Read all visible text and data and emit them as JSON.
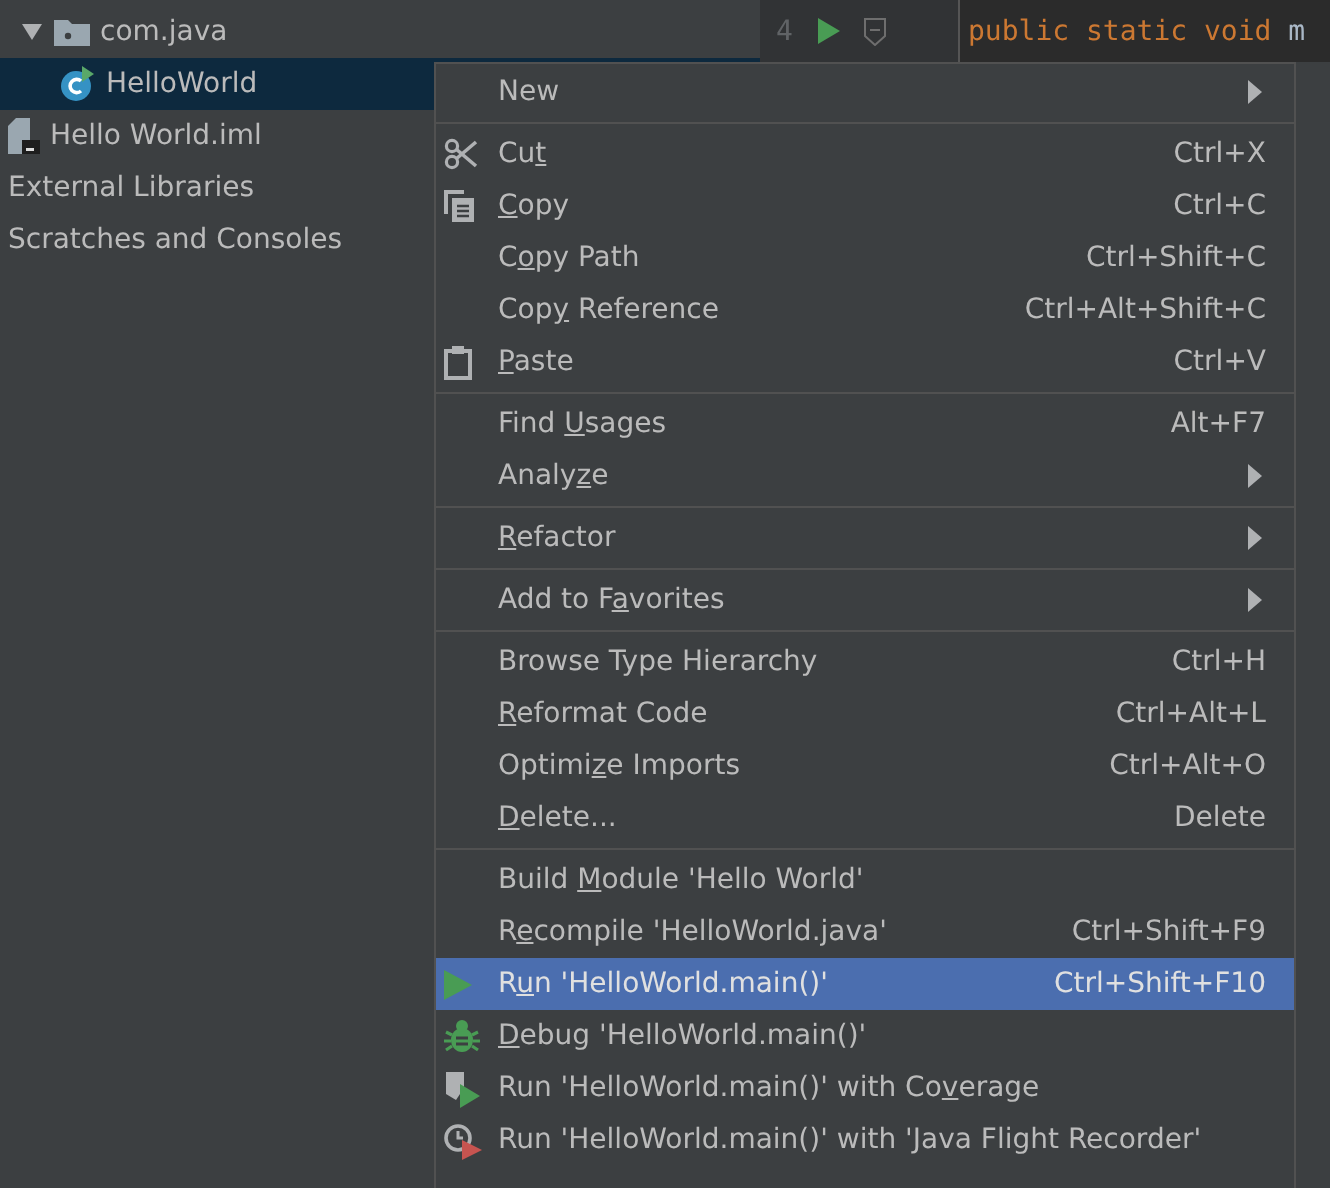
{
  "project_tree": [
    {
      "label": "com.java",
      "kind": "package",
      "expanded": true,
      "selected": false,
      "children": [
        {
          "label": "HelloWorld",
          "kind": "class",
          "selected": true
        }
      ]
    },
    {
      "label": "Hello World.iml",
      "kind": "file",
      "selected": false
    },
    {
      "label": "External Libraries",
      "kind": "plain",
      "selected": false
    },
    {
      "label": "Scratches and Consoles",
      "kind": "plain",
      "selected": false
    }
  ],
  "editor": {
    "line_number": "4",
    "code": [
      {
        "text": "public static void ",
        "kind": "keyword"
      },
      {
        "text": "m",
        "kind": "plain"
      }
    ]
  },
  "context_menu": {
    "groups": [
      [
        {
          "label": [
            {
              "text": "New",
              "underlined": false
            }
          ],
          "kind": "submenu",
          "selected": false
        }
      ],
      [
        {
          "label": [
            {
              "text": "Cu",
              "underlined": false
            },
            {
              "text": "t",
              "underlined": true
            }
          ],
          "shortcut": "Ctrl+X",
          "kind": "command",
          "selected": false
        },
        {
          "label": [
            {
              "text": "C",
              "underlined": true
            },
            {
              "text": "opy",
              "underlined": false
            }
          ],
          "shortcut": "Ctrl+C",
          "kind": "command",
          "selected": false
        },
        {
          "label": [
            {
              "text": "C",
              "underlined": false
            },
            {
              "text": "o",
              "underlined": true
            },
            {
              "text": "py Path",
              "underlined": false
            }
          ],
          "shortcut": "Ctrl+Shift+C",
          "kind": "command",
          "selected": false
        },
        {
          "label": [
            {
              "text": "Cop",
              "underlined": false
            },
            {
              "text": "y",
              "underlined": true
            },
            {
              "text": " Reference",
              "underlined": false
            }
          ],
          "shortcut": "Ctrl+Alt+Shift+C",
          "kind": "command",
          "selected": false
        },
        {
          "label": [
            {
              "text": "P",
              "underlined": true
            },
            {
              "text": "aste",
              "underlined": false
            }
          ],
          "shortcut": "Ctrl+V",
          "kind": "command",
          "selected": false
        }
      ],
      [
        {
          "label": [
            {
              "text": "Find ",
              "underlined": false
            },
            {
              "text": "U",
              "underlined": true
            },
            {
              "text": "sages",
              "underlined": false
            }
          ],
          "shortcut": "Alt+F7",
          "kind": "command",
          "selected": false
        },
        {
          "label": [
            {
              "text": "Analy",
              "underlined": false
            },
            {
              "text": "z",
              "underlined": true
            },
            {
              "text": "e",
              "underlined": false
            }
          ],
          "kind": "submenu",
          "selected": false
        }
      ],
      [
        {
          "label": [
            {
              "text": "R",
              "underlined": true
            },
            {
              "text": "efactor",
              "underlined": false
            }
          ],
          "kind": "submenu",
          "selected": false
        }
      ],
      [
        {
          "label": [
            {
              "text": "Add to F",
              "underlined": false
            },
            {
              "text": "a",
              "underlined": true
            },
            {
              "text": "vorites",
              "underlined": false
            }
          ],
          "kind": "submenu",
          "selected": false
        }
      ],
      [
        {
          "label": [
            {
              "text": "Browse Type Hierarchy",
              "underlined": false
            }
          ],
          "shortcut": "Ctrl+H",
          "kind": "command",
          "selected": false
        },
        {
          "label": [
            {
              "text": "R",
              "underlined": true
            },
            {
              "text": "eformat Code",
              "underlined": false
            }
          ],
          "shortcut": "Ctrl+Alt+L",
          "kind": "command",
          "selected": false
        },
        {
          "label": [
            {
              "text": "Optimi",
              "underlined": false
            },
            {
              "text": "z",
              "underlined": true
            },
            {
              "text": "e Imports",
              "underlined": false
            }
          ],
          "shortcut": "Ctrl+Alt+O",
          "kind": "command",
          "selected": false
        },
        {
          "label": [
            {
              "text": "D",
              "underlined": true
            },
            {
              "text": "elete...",
              "underlined": false
            }
          ],
          "shortcut": "Delete",
          "kind": "command",
          "selected": false
        }
      ],
      [
        {
          "label": [
            {
              "text": "Build ",
              "underlined": false
            },
            {
              "text": "M",
              "underlined": true
            },
            {
              "text": "odule 'Hello World'",
              "underlined": false
            }
          ],
          "kind": "command",
          "selected": false
        },
        {
          "label": [
            {
              "text": "R",
              "underlined": false
            },
            {
              "text": "e",
              "underlined": true
            },
            {
              "text": "compile 'HelloWorld.java'",
              "underlined": false
            }
          ],
          "shortcut": "Ctrl+Shift+F9",
          "kind": "command",
          "selected": false
        },
        {
          "label": [
            {
              "text": "R",
              "underlined": false
            },
            {
              "text": "u",
              "underlined": true
            },
            {
              "text": "n 'HelloWorld.main()'",
              "underlined": false
            }
          ],
          "shortcut": "Ctrl+Shift+F10",
          "kind": "command",
          "selected": true
        },
        {
          "label": [
            {
              "text": "D",
              "underlined": true
            },
            {
              "text": "ebug 'HelloWorld.main()'",
              "underlined": false
            }
          ],
          "kind": "command",
          "selected": false
        },
        {
          "label": [
            {
              "text": "Run 'HelloWorld.main()' with Co",
              "underlined": false
            },
            {
              "text": "v",
              "underlined": true
            },
            {
              "text": "erage",
              "underlined": false
            }
          ],
          "kind": "command",
          "selected": false
        },
        {
          "label": [
            {
              "text": "Run 'HelloWorld.main()' with 'Java Flight Recorder'",
              "underlined": false
            }
          ],
          "kind": "command",
          "selected": false
        }
      ]
    ]
  }
}
